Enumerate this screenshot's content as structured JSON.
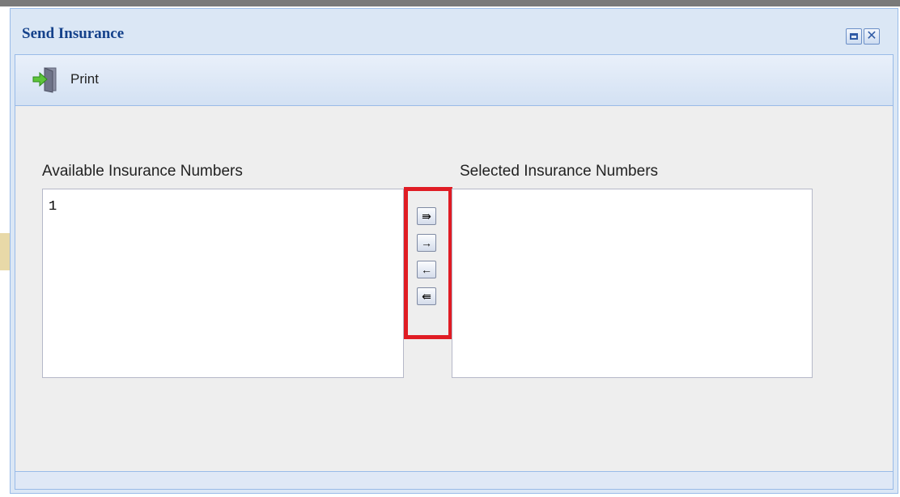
{
  "dialog": {
    "title": "Send Insurance",
    "maximize_icon": "maximize-icon",
    "close_icon": "close-icon"
  },
  "toolbar": {
    "print_label": "Print",
    "print_icon": "exit-door-arrow-icon"
  },
  "available_list": {
    "label": "Available Insurance Numbers",
    "items": [
      "1"
    ]
  },
  "selected_list": {
    "label": "Selected Insurance Numbers",
    "items": []
  },
  "mover_buttons": [
    {
      "name": "move-all-right-button",
      "glyph": "⇛",
      "icon": "double-arrow-right-icon"
    },
    {
      "name": "move-right-button",
      "glyph": "→",
      "icon": "arrow-right-icon"
    },
    {
      "name": "move-left-button",
      "glyph": "←",
      "icon": "arrow-left-icon"
    },
    {
      "name": "move-all-left-button",
      "glyph": "⇚",
      "icon": "double-arrow-left-icon"
    }
  ],
  "colors": {
    "title": "#15428b",
    "highlight_border": "#e01c24",
    "panel_border": "#99bbe8"
  }
}
